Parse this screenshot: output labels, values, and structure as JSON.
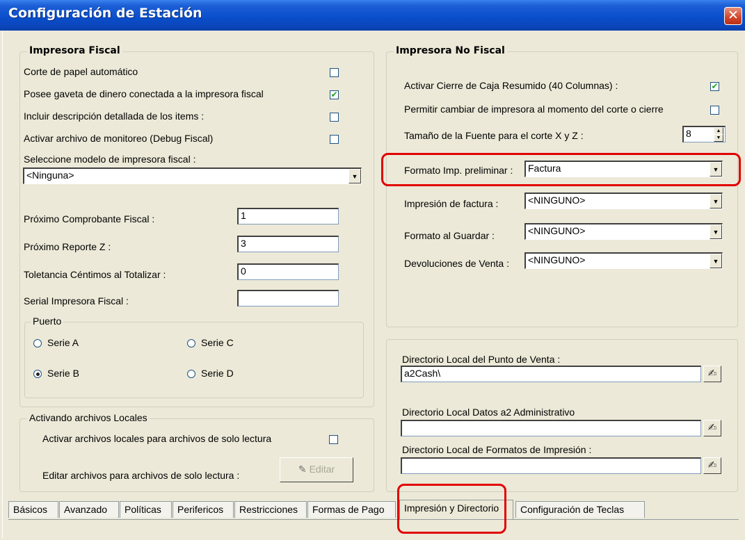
{
  "window": {
    "title": "Configuración de Estación",
    "close_icon": "✕"
  },
  "fiscal": {
    "title": "Impresora Fiscal",
    "options": [
      {
        "label": "Corte de papel automático",
        "checked": false
      },
      {
        "label": "Posee gaveta de dinero conectada a la impresora fiscal",
        "checked": true
      },
      {
        "label": "Incluir  descripción detallada de los items :",
        "checked": false
      },
      {
        "label": "Activar archivo de monitoreo (Debug Fiscal)",
        "checked": false
      }
    ],
    "model_label": "Seleccione modelo de impresora fiscal :",
    "model_value": "<Ninguna>",
    "prox_comprobante_label": "Próximo Comprobante Fiscal :",
    "prox_comprobante_value": "1",
    "prox_reporte_label": "Próximo Reporte Z :",
    "prox_reporte_value": "3",
    "tolerancia_label": "Toletancia Céntimos al Totalizar :",
    "tolerancia_value": "0",
    "serial_label": "Serial Impresora Fiscal :",
    "serial_value": "",
    "puerto": {
      "title": "Puerto",
      "serie_a": "Serie A",
      "serie_b": "Serie B",
      "serie_c": "Serie C",
      "serie_d": "Serie D",
      "selected": "Serie B"
    }
  },
  "locales": {
    "title": "Activando archivos Locales",
    "activar_label": "Activar archivos locales para archivos de solo lectura",
    "activar_checked": false,
    "editar_label": "Editar archivos para  archivos de solo lectura :",
    "editar_button": "Editar"
  },
  "no_fiscal": {
    "title": "Impresora No Fiscal",
    "cierre_label": "Activar Cierre de Caja Resumido (40 Columnas) :",
    "cierre_checked": true,
    "permitir_label": "Permitir cambiar de impresora al momento del corte o cierre",
    "permitir_checked": false,
    "fuente_label": "Tamaño de la Fuente para el corte X y Z :",
    "fuente_value": "8",
    "formato_prelim_label": "Formato Imp. preliminar :",
    "formato_prelim_value": "Factura",
    "impresion_factura_label": "Impresión de factura  :",
    "impresion_factura_value": "<NINGUNO>",
    "formato_guardar_label": "Formato al Guardar  :",
    "formato_guardar_value": "<NINGUNO>",
    "devoluciones_label": "Devoluciones de Venta  :",
    "devoluciones_value": "<NINGUNO>"
  },
  "directorios": {
    "local_pv_label": "Directorio Local del Punto de Venta :",
    "local_pv_value": "a2Cash\\",
    "local_datos_label": "Directorio Local Datos a2 Administrativo",
    "local_datos_value": "",
    "local_formatos_label": "Directorio Local de Formatos de Impresión :",
    "local_formatos_value": ""
  },
  "tabs": [
    "Básicos",
    "Avanzado",
    "Políticas",
    "Perifericos",
    "Restricciones",
    "Formas de Pago",
    "Impresión y Directorio",
    "Configuración de Teclas"
  ],
  "active_tab": "Impresión y Directorio",
  "colors": {
    "title_bar": "#0A4FCC",
    "highlight": "#E10000",
    "background": "#ECE9D8"
  }
}
